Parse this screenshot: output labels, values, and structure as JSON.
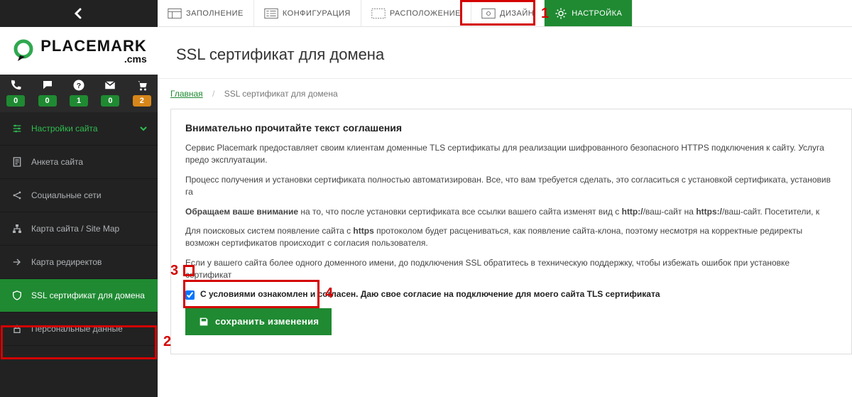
{
  "logo": {
    "name": "PLACEMARK",
    "suffix": ".cms"
  },
  "counters": [
    {
      "icon": "phone",
      "value": "0",
      "style": "ok"
    },
    {
      "icon": "chat",
      "value": "0",
      "style": "ok"
    },
    {
      "icon": "help",
      "value": "1",
      "style": "ok"
    },
    {
      "icon": "mail",
      "value": "0",
      "style": "ok"
    },
    {
      "icon": "cart",
      "value": "2",
      "style": "warn"
    }
  ],
  "sidebar": {
    "items": [
      {
        "icon": "sliders",
        "label": "Настройки сайта",
        "active_top": true
      },
      {
        "icon": "form",
        "label": "Анкета сайта"
      },
      {
        "icon": "share",
        "label": "Социальные сети"
      },
      {
        "icon": "sitemap",
        "label": "Карта сайта / Site Map"
      },
      {
        "icon": "redirect",
        "label": "Карта редиректов"
      },
      {
        "icon": "shield",
        "label": "SSL сертификат для домена",
        "selected": true
      },
      {
        "icon": "lock",
        "label": "Персональные данные"
      }
    ]
  },
  "tabs": [
    {
      "icon": "fill",
      "label": "ЗАПОЛНЕНИЕ"
    },
    {
      "icon": "config",
      "label": "КОНФИГУРАЦИЯ"
    },
    {
      "icon": "layout",
      "label": "РАСПОЛОЖЕНИЕ"
    },
    {
      "icon": "design",
      "label": "ДИЗАЙН"
    },
    {
      "icon": "gear",
      "label": "НАСТРОЙКА",
      "active": true
    }
  ],
  "page": {
    "title": "SSL сертификат для домена",
    "crumb_home": "Главная",
    "crumb_current": "SSL сертификат для домена"
  },
  "agreement": {
    "heading": "Внимательно прочитайте текст соглашения",
    "p1": "Сервис Placemark предоставляет своим клиентам доменные TLS сертификаты для реализации шифрованного безопасного HTTPS подключения к сайту. Услуга предо эксплуатации.",
    "p2": "Процесс получения и установки сертификата полностью автоматизирован. Все, что вам требуется сделать, это согласиться с установкой сертификата, установив га",
    "p3_before": "Обращаем ваше внимание",
    "p3_after": " на то, что после установки сертификата все ссылки вашего сайта изменят вид с ",
    "p3_http": "http:/",
    "p3_mid": "/ваш-сайт на ",
    "p3_https": "https:/",
    "p3_end": "/ваш-сайт. Посетители, к",
    "p4_a": "Для поисковых систем появление сайта с ",
    "p4_b": "https",
    "p4_c": " протоколом будет расцениваться, как появление сайта-клона, поэтому несмотря на корректные редиректы возможн сертификатов происходит с согласия пользователя.",
    "p5": "Если у вашего сайта более одного доменного имени, до подключения SSL обратитесь в техническую поддержку, чтобы избежать ошибок при установке сертификат",
    "checkbox_label": "С условиями ознакомлен и согласен. Даю свое согласие на подключение для моего сайта TLS сертификата",
    "save_label": "сохранить изменения"
  },
  "annotations": {
    "n1": "1",
    "n2": "2",
    "n3": "3",
    "n4": "4"
  }
}
